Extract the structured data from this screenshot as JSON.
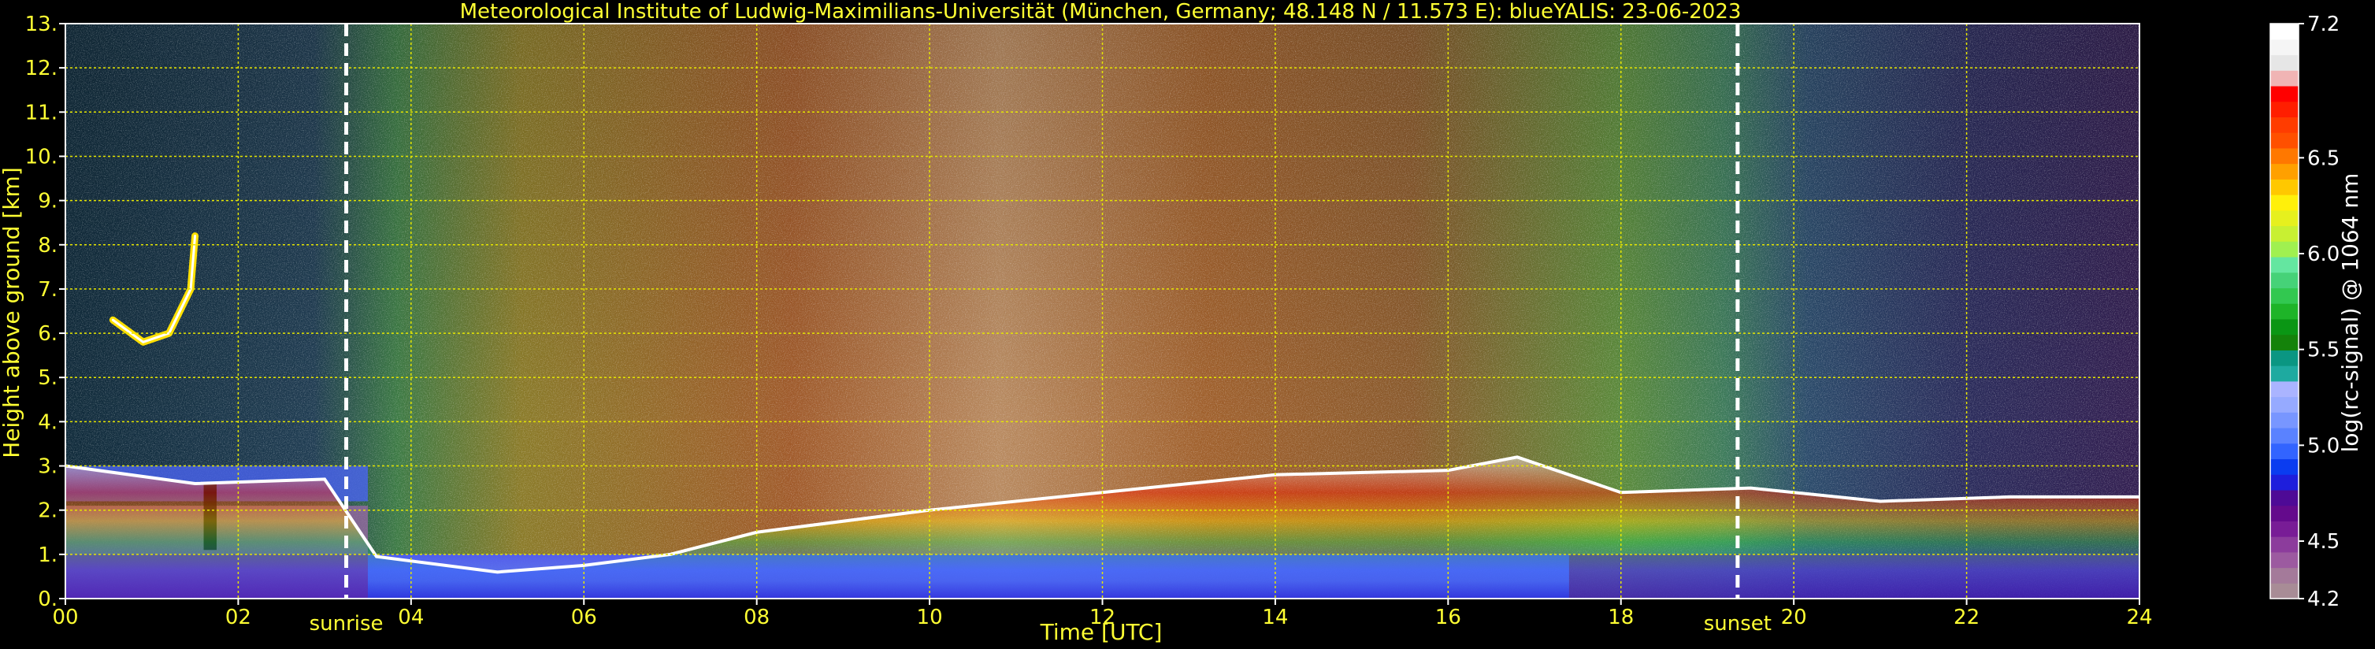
{
  "chart_data": {
    "type": "heatmap",
    "title": "Meteorological Institute of Ludwig-Maximilians-Universität (München, Germany; 48.148 N / 11.573 E):    blueYALIS: 23-06-2023",
    "xlabel": "Time [UTC]",
    "ylabel": "Height above ground [km]",
    "xlim": [
      0,
      24
    ],
    "ylim": [
      0,
      13
    ],
    "x_ticks": [
      "00",
      "02",
      "04",
      "06",
      "08",
      "10",
      "12",
      "14",
      "16",
      "18",
      "20",
      "22",
      "24"
    ],
    "y_ticks": [
      "0.",
      "1.",
      "2.",
      "3.",
      "4.",
      "5.",
      "6.",
      "7.",
      "8.",
      "9.",
      "10.",
      "11.",
      "12.",
      "13."
    ],
    "grid": true,
    "markers": [
      {
        "label": "sunrise",
        "time": 3.25
      },
      {
        "label": "sunset",
        "time": 19.35
      }
    ],
    "colorbar": {
      "label": "log(rc-signal) @ 1064 nm",
      "range": [
        4.2,
        7.2
      ],
      "ticks": [
        "4.2",
        "4.5",
        "5.0",
        "5.5",
        "6.0",
        "6.5",
        "7.2"
      ],
      "colors": [
        "#a88c96",
        "#a47a9a",
        "#9c5aa0",
        "#8c3c9c",
        "#781c96",
        "#640a8c",
        "#4e0a96",
        "#1e1edc",
        "#0a3cf0",
        "#3264ff",
        "#5a82ff",
        "#7896ff",
        "#96aaff",
        "#aab4ff",
        "#1eaaa0",
        "#0a9682",
        "#14820a",
        "#0a9614",
        "#1eb428",
        "#32c850",
        "#46d278",
        "#64e6a0",
        "#a0f050",
        "#c8f032",
        "#e6f01e",
        "#fff00a",
        "#ffc800",
        "#ffa000",
        "#ff7800",
        "#ff5000",
        "#ff3c00",
        "#ff1e00",
        "#ff0000",
        "#f0b4b4",
        "#e6e6e6",
        "#f5f5f5",
        "#ffffff"
      ]
    },
    "features": {
      "aerosol_layer_top_km": [
        {
          "time": 0.0,
          "km": 3.0
        },
        {
          "time": 1.5,
          "km": 2.6
        },
        {
          "time": 3.0,
          "km": 2.7
        },
        {
          "time": 3.6,
          "km": 0.95
        },
        {
          "time": 5.0,
          "km": 0.6
        },
        {
          "time": 6.0,
          "km": 0.75
        },
        {
          "time": 7.0,
          "km": 1.0
        },
        {
          "time": 8.0,
          "km": 1.5
        },
        {
          "time": 10.0,
          "km": 2.0
        },
        {
          "time": 12.0,
          "km": 2.4
        },
        {
          "time": 14.0,
          "km": 2.8
        },
        {
          "time": 16.0,
          "km": 2.9
        },
        {
          "time": 16.8,
          "km": 3.2
        },
        {
          "time": 18.0,
          "km": 2.4
        },
        {
          "time": 19.5,
          "km": 2.5
        },
        {
          "time": 21.0,
          "km": 2.2
        },
        {
          "time": 22.5,
          "km": 2.3
        },
        {
          "time": 24.0,
          "km": 2.3
        }
      ],
      "elevated_layer": [
        {
          "time": 0.55,
          "km": 6.3
        },
        {
          "time": 0.9,
          "km": 5.8
        },
        {
          "time": 1.2,
          "km": 6.0
        },
        {
          "time": 1.45,
          "km": 7.0
        },
        {
          "time": 1.5,
          "km": 8.2
        }
      ]
    }
  }
}
